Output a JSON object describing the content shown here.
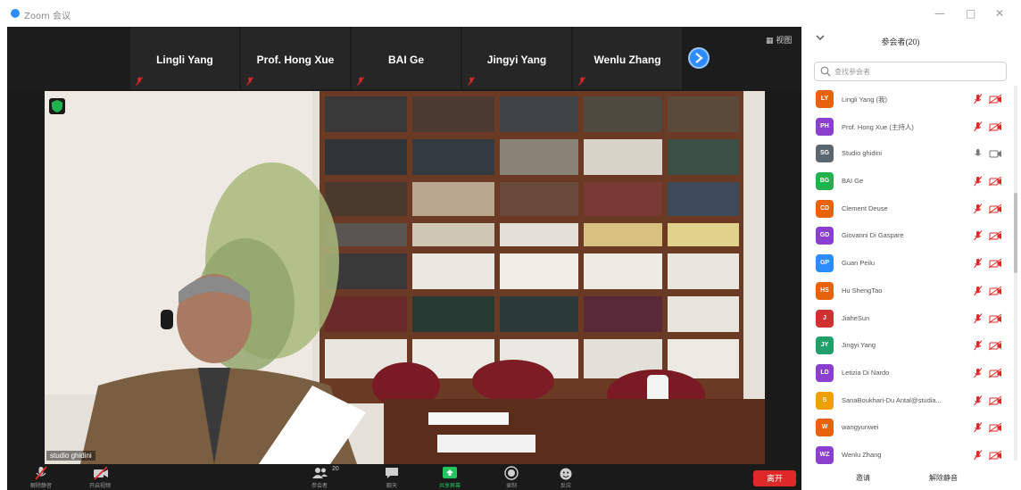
{
  "window": {
    "title": "Zoom 会议",
    "minimize_glyph": "—",
    "maximize_glyph": "□",
    "close_glyph": "✕"
  },
  "gallery": {
    "tiles": [
      {
        "name": "Lingli Yang"
      },
      {
        "name": "Prof. Hong Xue"
      },
      {
        "name": "BAI Ge"
      },
      {
        "name": "Jingyi Yang"
      },
      {
        "name": "Wenlu Zhang"
      }
    ],
    "view_label": "▦ 视图"
  },
  "speaker": {
    "label": "studio ghidini"
  },
  "toolbar": {
    "mute": "解除静音",
    "video": "开启视频",
    "participants": "参会者",
    "participant_count": "20",
    "chat": "聊天",
    "share": "共享屏幕",
    "record": "录制",
    "reactions": "反应",
    "leave": "离开",
    "share_color": "#22c55e",
    "leave_color": "#e02828"
  },
  "panel": {
    "title": "参会者(20)",
    "search_placeholder": "查找参会者",
    "participants": [
      {
        "initials": "LY",
        "name": "Lingli Yang (我)",
        "color": "#e8620c",
        "audio": "muted",
        "video": "off"
      },
      {
        "initials": "PH",
        "name": "Prof. Hong Xue (主持人)",
        "color": "#8b3fcf",
        "audio": "muted",
        "video": "off"
      },
      {
        "initials": "SG",
        "name": "Studio ghidini",
        "color": "#5a6670",
        "audio": "on",
        "video": "on"
      },
      {
        "initials": "BG",
        "name": "BAI Ge",
        "color": "#22b14c",
        "audio": "muted",
        "video": "off"
      },
      {
        "initials": "CD",
        "name": "Clement Deuse",
        "color": "#e8620c",
        "audio": "muted",
        "video": "off"
      },
      {
        "initials": "GD",
        "name": "Giovanni Di Gaspare",
        "color": "#8b3fcf",
        "audio": "muted",
        "video": "off"
      },
      {
        "initials": "GP",
        "name": "Guan Peilu",
        "color": "#2d8cff",
        "audio": "muted",
        "video": "off"
      },
      {
        "initials": "HS",
        "name": "Hu ShengTao",
        "color": "#e8620c",
        "audio": "muted",
        "video": "off"
      },
      {
        "initials": "J",
        "name": "JiaheSun",
        "color": "#d03030",
        "audio": "muted",
        "video": "off"
      },
      {
        "initials": "JY",
        "name": "Jingyi Yang",
        "color": "#22a06b",
        "audio": "muted",
        "video": "off"
      },
      {
        "initials": "LD",
        "name": "Letizia Di Nardo",
        "color": "#8b3fcf",
        "audio": "muted",
        "video": "off"
      },
      {
        "initials": "S",
        "name": "SanaBoukhari-Du Antal@studia...",
        "color": "#f0a000",
        "audio": "muted",
        "video": "off"
      },
      {
        "initials": "W",
        "name": "wangyunwei",
        "color": "#e8620c",
        "audio": "muted",
        "video": "off"
      },
      {
        "initials": "WZ",
        "name": "Wenlu Zhang",
        "color": "#8b3fcf",
        "audio": "muted",
        "video": "off"
      }
    ],
    "invite": "邀请",
    "unmute_all": "解除静音"
  }
}
